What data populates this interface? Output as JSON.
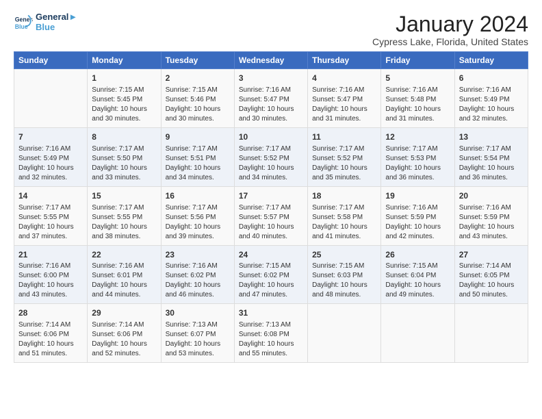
{
  "header": {
    "logo_line1": "General",
    "logo_line2": "Blue",
    "title": "January 2024",
    "subtitle": "Cypress Lake, Florida, United States"
  },
  "days_of_week": [
    "Sunday",
    "Monday",
    "Tuesday",
    "Wednesday",
    "Thursday",
    "Friday",
    "Saturday"
  ],
  "weeks": [
    [
      {
        "day": "",
        "content": ""
      },
      {
        "day": "1",
        "content": "Sunrise: 7:15 AM\nSunset: 5:45 PM\nDaylight: 10 hours\nand 30 minutes."
      },
      {
        "day": "2",
        "content": "Sunrise: 7:15 AM\nSunset: 5:46 PM\nDaylight: 10 hours\nand 30 minutes."
      },
      {
        "day": "3",
        "content": "Sunrise: 7:16 AM\nSunset: 5:47 PM\nDaylight: 10 hours\nand 30 minutes."
      },
      {
        "day": "4",
        "content": "Sunrise: 7:16 AM\nSunset: 5:47 PM\nDaylight: 10 hours\nand 31 minutes."
      },
      {
        "day": "5",
        "content": "Sunrise: 7:16 AM\nSunset: 5:48 PM\nDaylight: 10 hours\nand 31 minutes."
      },
      {
        "day": "6",
        "content": "Sunrise: 7:16 AM\nSunset: 5:49 PM\nDaylight: 10 hours\nand 32 minutes."
      }
    ],
    [
      {
        "day": "7",
        "content": "Sunrise: 7:16 AM\nSunset: 5:49 PM\nDaylight: 10 hours\nand 32 minutes."
      },
      {
        "day": "8",
        "content": "Sunrise: 7:17 AM\nSunset: 5:50 PM\nDaylight: 10 hours\nand 33 minutes."
      },
      {
        "day": "9",
        "content": "Sunrise: 7:17 AM\nSunset: 5:51 PM\nDaylight: 10 hours\nand 34 minutes."
      },
      {
        "day": "10",
        "content": "Sunrise: 7:17 AM\nSunset: 5:52 PM\nDaylight: 10 hours\nand 34 minutes."
      },
      {
        "day": "11",
        "content": "Sunrise: 7:17 AM\nSunset: 5:52 PM\nDaylight: 10 hours\nand 35 minutes."
      },
      {
        "day": "12",
        "content": "Sunrise: 7:17 AM\nSunset: 5:53 PM\nDaylight: 10 hours\nand 36 minutes."
      },
      {
        "day": "13",
        "content": "Sunrise: 7:17 AM\nSunset: 5:54 PM\nDaylight: 10 hours\nand 36 minutes."
      }
    ],
    [
      {
        "day": "14",
        "content": "Sunrise: 7:17 AM\nSunset: 5:55 PM\nDaylight: 10 hours\nand 37 minutes."
      },
      {
        "day": "15",
        "content": "Sunrise: 7:17 AM\nSunset: 5:55 PM\nDaylight: 10 hours\nand 38 minutes."
      },
      {
        "day": "16",
        "content": "Sunrise: 7:17 AM\nSunset: 5:56 PM\nDaylight: 10 hours\nand 39 minutes."
      },
      {
        "day": "17",
        "content": "Sunrise: 7:17 AM\nSunset: 5:57 PM\nDaylight: 10 hours\nand 40 minutes."
      },
      {
        "day": "18",
        "content": "Sunrise: 7:17 AM\nSunset: 5:58 PM\nDaylight: 10 hours\nand 41 minutes."
      },
      {
        "day": "19",
        "content": "Sunrise: 7:16 AM\nSunset: 5:59 PM\nDaylight: 10 hours\nand 42 minutes."
      },
      {
        "day": "20",
        "content": "Sunrise: 7:16 AM\nSunset: 5:59 PM\nDaylight: 10 hours\nand 43 minutes."
      }
    ],
    [
      {
        "day": "21",
        "content": "Sunrise: 7:16 AM\nSunset: 6:00 PM\nDaylight: 10 hours\nand 43 minutes."
      },
      {
        "day": "22",
        "content": "Sunrise: 7:16 AM\nSunset: 6:01 PM\nDaylight: 10 hours\nand 44 minutes."
      },
      {
        "day": "23",
        "content": "Sunrise: 7:16 AM\nSunset: 6:02 PM\nDaylight: 10 hours\nand 46 minutes."
      },
      {
        "day": "24",
        "content": "Sunrise: 7:15 AM\nSunset: 6:02 PM\nDaylight: 10 hours\nand 47 minutes."
      },
      {
        "day": "25",
        "content": "Sunrise: 7:15 AM\nSunset: 6:03 PM\nDaylight: 10 hours\nand 48 minutes."
      },
      {
        "day": "26",
        "content": "Sunrise: 7:15 AM\nSunset: 6:04 PM\nDaylight: 10 hours\nand 49 minutes."
      },
      {
        "day": "27",
        "content": "Sunrise: 7:14 AM\nSunset: 6:05 PM\nDaylight: 10 hours\nand 50 minutes."
      }
    ],
    [
      {
        "day": "28",
        "content": "Sunrise: 7:14 AM\nSunset: 6:06 PM\nDaylight: 10 hours\nand 51 minutes."
      },
      {
        "day": "29",
        "content": "Sunrise: 7:14 AM\nSunset: 6:06 PM\nDaylight: 10 hours\nand 52 minutes."
      },
      {
        "day": "30",
        "content": "Sunrise: 7:13 AM\nSunset: 6:07 PM\nDaylight: 10 hours\nand 53 minutes."
      },
      {
        "day": "31",
        "content": "Sunrise: 7:13 AM\nSunset: 6:08 PM\nDaylight: 10 hours\nand 55 minutes."
      },
      {
        "day": "",
        "content": ""
      },
      {
        "day": "",
        "content": ""
      },
      {
        "day": "",
        "content": ""
      }
    ]
  ]
}
